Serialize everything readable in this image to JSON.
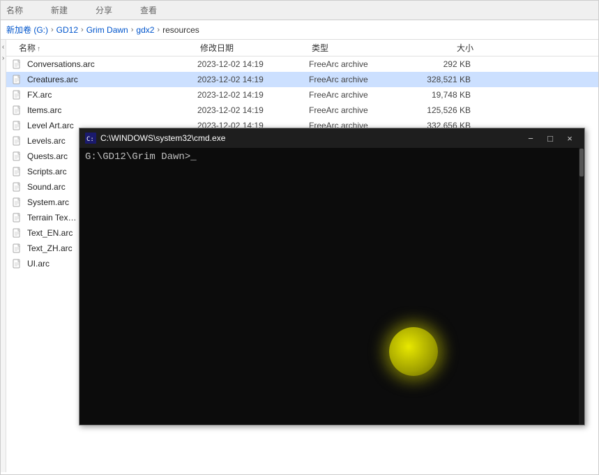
{
  "breadcrumb": {
    "items": [
      "新加卷 (G:)",
      "GD12",
      "Grim Dawn",
      "gdx2",
      "resources"
    ]
  },
  "tabs": {
    "labels": [
      "名称",
      "新建",
      "分享",
      "查看"
    ]
  },
  "columns": {
    "name": "名称",
    "date": "修改日期",
    "type": "类型",
    "size": "大小",
    "sort_arrow": "↑"
  },
  "files": [
    {
      "name": "Conversations.arc",
      "date": "2023-12-02 14:19",
      "type": "FreeArc archive",
      "size": "292 KB"
    },
    {
      "name": "Creatures.arc",
      "date": "2023-12-02 14:19",
      "type": "FreeArc archive",
      "size": "328,521 KB",
      "selected": true
    },
    {
      "name": "FX.arc",
      "date": "2023-12-02 14:19",
      "type": "FreeArc archive",
      "size": "19,748 KB"
    },
    {
      "name": "Items.arc",
      "date": "2023-12-02 14:19",
      "type": "FreeArc archive",
      "size": "125,526 KB"
    },
    {
      "name": "Level Art.arc",
      "date": "2023-12-02 14:19",
      "type": "FreeArc archive",
      "size": "332,656 KB"
    },
    {
      "name": "Levels.arc",
      "date": "",
      "type": "",
      "size": ""
    },
    {
      "name": "Quests.arc",
      "date": "",
      "type": "",
      "size": ""
    },
    {
      "name": "Scripts.arc",
      "date": "",
      "type": "",
      "size": ""
    },
    {
      "name": "Sound.arc",
      "date": "",
      "type": "",
      "size": ""
    },
    {
      "name": "System.arc",
      "date": "",
      "type": "",
      "size": ""
    },
    {
      "name": "Terrain Tex…",
      "date": "",
      "type": "",
      "size": ""
    },
    {
      "name": "Text_EN.arc",
      "date": "",
      "type": "",
      "size": ""
    },
    {
      "name": "Text_ZH.arc",
      "date": "",
      "type": "",
      "size": ""
    },
    {
      "name": "UI.arc",
      "date": "",
      "type": "",
      "size": ""
    }
  ],
  "cmd": {
    "title": "C:\\WINDOWS\\system32\\cmd.exe",
    "prompt": "G:\\GD12\\Grim Dawn>",
    "controls": {
      "minimize": "−",
      "maximize": "□",
      "close": "×"
    }
  }
}
